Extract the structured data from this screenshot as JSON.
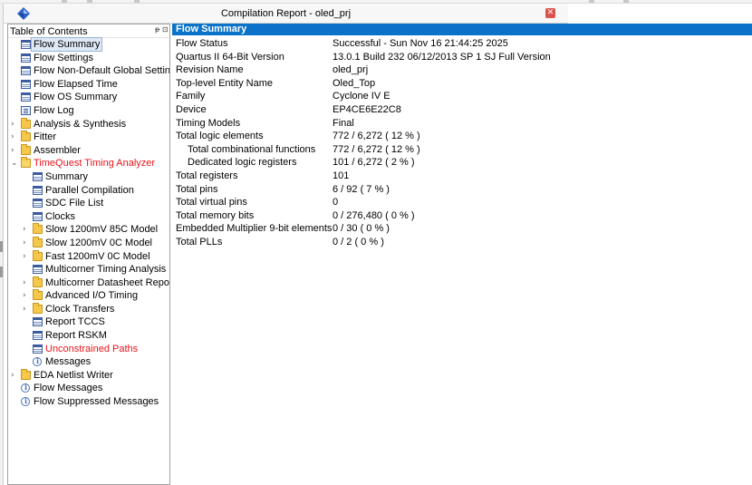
{
  "window": {
    "title": "Compilation Report - oled_prj",
    "close_glyph": "✕"
  },
  "toc": {
    "header": "Table of Contents",
    "pin_glyph": "ᵽ ⊡",
    "items": [
      {
        "label": "Flow Summary",
        "icon": "table-icon",
        "indent": 0,
        "arrow": "",
        "selected": true,
        "red": false
      },
      {
        "label": "Flow Settings",
        "icon": "table-icon",
        "indent": 0,
        "arrow": "",
        "selected": false,
        "red": false
      },
      {
        "label": "Flow Non-Default Global Settings",
        "icon": "table-icon",
        "indent": 0,
        "arrow": "",
        "selected": false,
        "red": false
      },
      {
        "label": "Flow Elapsed Time",
        "icon": "table-icon",
        "indent": 0,
        "arrow": "",
        "selected": false,
        "red": false
      },
      {
        "label": "Flow OS Summary",
        "icon": "table-icon",
        "indent": 0,
        "arrow": "",
        "selected": false,
        "red": false
      },
      {
        "label": "Flow Log",
        "icon": "log-icon",
        "indent": 0,
        "arrow": "",
        "selected": false,
        "red": false
      },
      {
        "label": "Analysis & Synthesis",
        "icon": "folder-icon",
        "indent": 0,
        "arrow": "›",
        "selected": false,
        "red": false
      },
      {
        "label": "Fitter",
        "icon": "folder-icon",
        "indent": 0,
        "arrow": "›",
        "selected": false,
        "red": false
      },
      {
        "label": "Assembler",
        "icon": "folder-icon",
        "indent": 0,
        "arrow": "›",
        "selected": false,
        "red": false
      },
      {
        "label": "TimeQuest Timing Analyzer",
        "icon": "folder-open-icon",
        "indent": 0,
        "arrow": "⌄",
        "selected": false,
        "red": true
      },
      {
        "label": "Summary",
        "icon": "table-icon",
        "indent": 1,
        "arrow": "",
        "selected": false,
        "red": false
      },
      {
        "label": "Parallel Compilation",
        "icon": "table-icon",
        "indent": 1,
        "arrow": "",
        "selected": false,
        "red": false
      },
      {
        "label": "SDC File List",
        "icon": "table-icon",
        "indent": 1,
        "arrow": "",
        "selected": false,
        "red": false
      },
      {
        "label": "Clocks",
        "icon": "table-icon",
        "indent": 1,
        "arrow": "",
        "selected": false,
        "red": false
      },
      {
        "label": "Slow 1200mV 85C Model",
        "icon": "folder-icon",
        "indent": 1,
        "arrow": "›",
        "selected": false,
        "red": false
      },
      {
        "label": "Slow 1200mV 0C Model",
        "icon": "folder-icon",
        "indent": 1,
        "arrow": "›",
        "selected": false,
        "red": false
      },
      {
        "label": "Fast 1200mV 0C Model",
        "icon": "folder-icon",
        "indent": 1,
        "arrow": "›",
        "selected": false,
        "red": false
      },
      {
        "label": "Multicorner Timing Analysis Su",
        "icon": "table-icon",
        "indent": 1,
        "arrow": "",
        "selected": false,
        "red": false
      },
      {
        "label": "Multicorner Datasheet Report S",
        "icon": "folder-icon",
        "indent": 1,
        "arrow": "›",
        "selected": false,
        "red": false
      },
      {
        "label": "Advanced I/O Timing",
        "icon": "folder-icon",
        "indent": 1,
        "arrow": "›",
        "selected": false,
        "red": false
      },
      {
        "label": "Clock Transfers",
        "icon": "folder-icon",
        "indent": 1,
        "arrow": "›",
        "selected": false,
        "red": false
      },
      {
        "label": "Report TCCS",
        "icon": "table-icon",
        "indent": 1,
        "arrow": "",
        "selected": false,
        "red": false
      },
      {
        "label": "Report RSKM",
        "icon": "table-icon",
        "indent": 1,
        "arrow": "",
        "selected": false,
        "red": false
      },
      {
        "label": "Unconstrained Paths",
        "icon": "table-icon",
        "indent": 1,
        "arrow": "",
        "selected": false,
        "red": true
      },
      {
        "label": "Messages",
        "icon": "info-icon",
        "indent": 1,
        "arrow": "",
        "selected": false,
        "red": false
      },
      {
        "label": "EDA Netlist Writer",
        "icon": "folder-icon",
        "indent": 0,
        "arrow": "›",
        "selected": false,
        "red": false
      },
      {
        "label": "Flow Messages",
        "icon": "info-icon",
        "indent": 0,
        "arrow": "",
        "selected": false,
        "red": false
      },
      {
        "label": "Flow Suppressed Messages",
        "icon": "info-icon",
        "indent": 0,
        "arrow": "",
        "selected": false,
        "red": false
      }
    ]
  },
  "summary": {
    "header": "Flow Summary",
    "rows": [
      {
        "key": "Flow Status",
        "value": "Successful - Sun Nov 16 21:44:25 2025",
        "sub": false
      },
      {
        "key": "Quartus II 64-Bit Version",
        "value": "13.0.1 Build 232 06/12/2013 SP 1 SJ Full Version",
        "sub": false
      },
      {
        "key": "Revision Name",
        "value": "oled_prj",
        "sub": false
      },
      {
        "key": "Top-level Entity Name",
        "value": "Oled_Top",
        "sub": false
      },
      {
        "key": "Family",
        "value": "Cyclone IV E",
        "sub": false
      },
      {
        "key": "Device",
        "value": "EP4CE6E22C8",
        "sub": false
      },
      {
        "key": "Timing Models",
        "value": "Final",
        "sub": false
      },
      {
        "key": "Total logic elements",
        "value": "772 / 6,272 ( 12 % )",
        "sub": false
      },
      {
        "key": "Total combinational functions",
        "value": "772 / 6,272 ( 12 % )",
        "sub": true
      },
      {
        "key": "Dedicated logic registers",
        "value": "101 / 6,272 ( 2 % )",
        "sub": true
      },
      {
        "key": "Total registers",
        "value": "101",
        "sub": false
      },
      {
        "key": "Total pins",
        "value": "6 / 92 ( 7 % )",
        "sub": false
      },
      {
        "key": "Total virtual pins",
        "value": "0",
        "sub": false
      },
      {
        "key": "Total memory bits",
        "value": "0 / 276,480 ( 0 % )",
        "sub": false
      },
      {
        "key": "Embedded Multiplier 9-bit elements",
        "value": "0 / 30 ( 0 % )",
        "sub": false
      },
      {
        "key": "Total PLLs",
        "value": "0 / 2 ( 0 % )",
        "sub": false
      }
    ]
  },
  "colors": {
    "header_blue": "#0a73c9",
    "alert_red": "#e8151c",
    "selection": "#dfe8f5"
  }
}
